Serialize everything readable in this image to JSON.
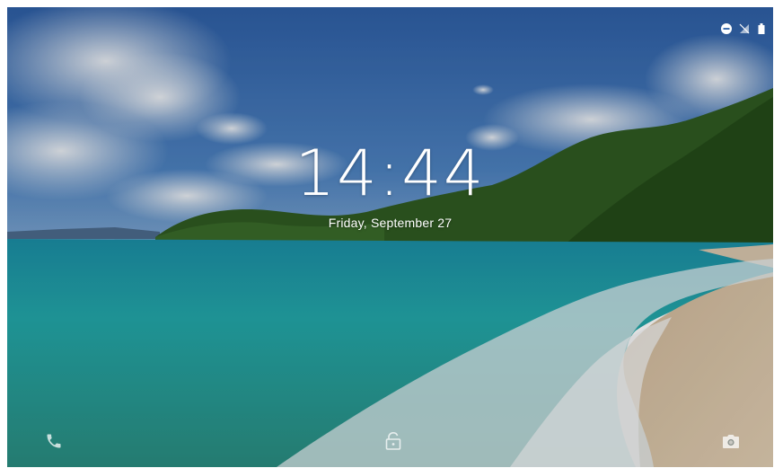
{
  "lockscreen": {
    "time": "14:44",
    "date": "Friday, September 27"
  },
  "status_icons": [
    "do-not-disturb-icon",
    "no-signal-icon",
    "battery-icon"
  ],
  "bottom_icons": [
    "phone-icon",
    "unlock-icon",
    "camera-icon"
  ],
  "colors": {
    "sky": "#3f71b8",
    "sea": "#22a6a8",
    "sand": "#d8c3a6",
    "hill": "#2f5a22",
    "text": "#ffffff"
  }
}
